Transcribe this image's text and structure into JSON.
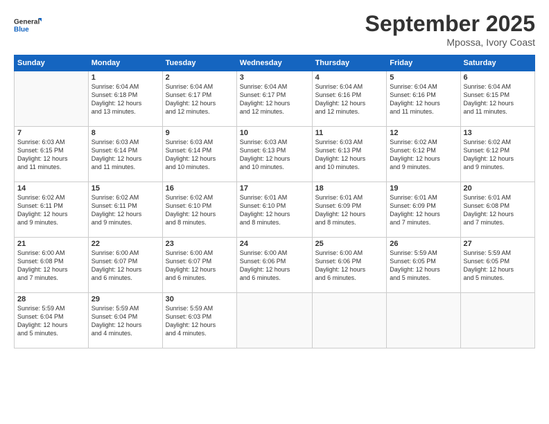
{
  "logo": {
    "line1": "General",
    "line2": "Blue"
  },
  "title": "September 2025",
  "location": "Mpossa, Ivory Coast",
  "days_of_week": [
    "Sunday",
    "Monday",
    "Tuesday",
    "Wednesday",
    "Thursday",
    "Friday",
    "Saturday"
  ],
  "weeks": [
    [
      {
        "day": "",
        "info": ""
      },
      {
        "day": "1",
        "info": "Sunrise: 6:04 AM\nSunset: 6:18 PM\nDaylight: 12 hours\nand 13 minutes."
      },
      {
        "day": "2",
        "info": "Sunrise: 6:04 AM\nSunset: 6:17 PM\nDaylight: 12 hours\nand 12 minutes."
      },
      {
        "day": "3",
        "info": "Sunrise: 6:04 AM\nSunset: 6:17 PM\nDaylight: 12 hours\nand 12 minutes."
      },
      {
        "day": "4",
        "info": "Sunrise: 6:04 AM\nSunset: 6:16 PM\nDaylight: 12 hours\nand 12 minutes."
      },
      {
        "day": "5",
        "info": "Sunrise: 6:04 AM\nSunset: 6:16 PM\nDaylight: 12 hours\nand 11 minutes."
      },
      {
        "day": "6",
        "info": "Sunrise: 6:04 AM\nSunset: 6:15 PM\nDaylight: 12 hours\nand 11 minutes."
      }
    ],
    [
      {
        "day": "7",
        "info": "Sunrise: 6:03 AM\nSunset: 6:15 PM\nDaylight: 12 hours\nand 11 minutes."
      },
      {
        "day": "8",
        "info": "Sunrise: 6:03 AM\nSunset: 6:14 PM\nDaylight: 12 hours\nand 11 minutes."
      },
      {
        "day": "9",
        "info": "Sunrise: 6:03 AM\nSunset: 6:14 PM\nDaylight: 12 hours\nand 10 minutes."
      },
      {
        "day": "10",
        "info": "Sunrise: 6:03 AM\nSunset: 6:13 PM\nDaylight: 12 hours\nand 10 minutes."
      },
      {
        "day": "11",
        "info": "Sunrise: 6:03 AM\nSunset: 6:13 PM\nDaylight: 12 hours\nand 10 minutes."
      },
      {
        "day": "12",
        "info": "Sunrise: 6:02 AM\nSunset: 6:12 PM\nDaylight: 12 hours\nand 9 minutes."
      },
      {
        "day": "13",
        "info": "Sunrise: 6:02 AM\nSunset: 6:12 PM\nDaylight: 12 hours\nand 9 minutes."
      }
    ],
    [
      {
        "day": "14",
        "info": "Sunrise: 6:02 AM\nSunset: 6:11 PM\nDaylight: 12 hours\nand 9 minutes."
      },
      {
        "day": "15",
        "info": "Sunrise: 6:02 AM\nSunset: 6:11 PM\nDaylight: 12 hours\nand 9 minutes."
      },
      {
        "day": "16",
        "info": "Sunrise: 6:02 AM\nSunset: 6:10 PM\nDaylight: 12 hours\nand 8 minutes."
      },
      {
        "day": "17",
        "info": "Sunrise: 6:01 AM\nSunset: 6:10 PM\nDaylight: 12 hours\nand 8 minutes."
      },
      {
        "day": "18",
        "info": "Sunrise: 6:01 AM\nSunset: 6:09 PM\nDaylight: 12 hours\nand 8 minutes."
      },
      {
        "day": "19",
        "info": "Sunrise: 6:01 AM\nSunset: 6:09 PM\nDaylight: 12 hours\nand 7 minutes."
      },
      {
        "day": "20",
        "info": "Sunrise: 6:01 AM\nSunset: 6:08 PM\nDaylight: 12 hours\nand 7 minutes."
      }
    ],
    [
      {
        "day": "21",
        "info": "Sunrise: 6:00 AM\nSunset: 6:08 PM\nDaylight: 12 hours\nand 7 minutes."
      },
      {
        "day": "22",
        "info": "Sunrise: 6:00 AM\nSunset: 6:07 PM\nDaylight: 12 hours\nand 6 minutes."
      },
      {
        "day": "23",
        "info": "Sunrise: 6:00 AM\nSunset: 6:07 PM\nDaylight: 12 hours\nand 6 minutes."
      },
      {
        "day": "24",
        "info": "Sunrise: 6:00 AM\nSunset: 6:06 PM\nDaylight: 12 hours\nand 6 minutes."
      },
      {
        "day": "25",
        "info": "Sunrise: 6:00 AM\nSunset: 6:06 PM\nDaylight: 12 hours\nand 6 minutes."
      },
      {
        "day": "26",
        "info": "Sunrise: 5:59 AM\nSunset: 6:05 PM\nDaylight: 12 hours\nand 5 minutes."
      },
      {
        "day": "27",
        "info": "Sunrise: 5:59 AM\nSunset: 6:05 PM\nDaylight: 12 hours\nand 5 minutes."
      }
    ],
    [
      {
        "day": "28",
        "info": "Sunrise: 5:59 AM\nSunset: 6:04 PM\nDaylight: 12 hours\nand 5 minutes."
      },
      {
        "day": "29",
        "info": "Sunrise: 5:59 AM\nSunset: 6:04 PM\nDaylight: 12 hours\nand 4 minutes."
      },
      {
        "day": "30",
        "info": "Sunrise: 5:59 AM\nSunset: 6:03 PM\nDaylight: 12 hours\nand 4 minutes."
      },
      {
        "day": "",
        "info": ""
      },
      {
        "day": "",
        "info": ""
      },
      {
        "day": "",
        "info": ""
      },
      {
        "day": "",
        "info": ""
      }
    ]
  ]
}
